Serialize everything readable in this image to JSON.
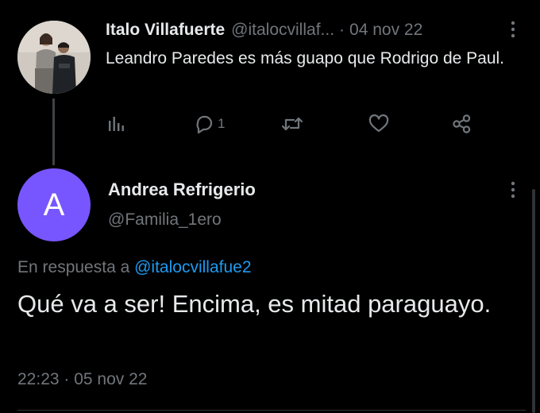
{
  "parent_tweet": {
    "author_name": "Italo Villafuerte",
    "author_handle": "@italocvillaf...",
    "separator": "·",
    "date": "04 nov 22",
    "text": "Leandro Paredes es más guapo que Rodrigo de Paul.",
    "actions": {
      "analytics_icon": "analytics-icon",
      "reply_icon": "reply-icon",
      "reply_count": "1",
      "retweet_icon": "retweet-icon",
      "like_icon": "like-icon",
      "share_icon": "share-icon"
    }
  },
  "reply_tweet": {
    "avatar_letter": "A",
    "avatar_color": "#7856ff",
    "author_name": "Andrea Refrigerio",
    "author_handle": "@Familia_1ero",
    "replying_to_label": "En respuesta a",
    "replying_to_handle": "@italocvillafue2",
    "text": "Qué va a ser! Encima, es mitad paraguayo.",
    "timestamp": "22:23 · 05 nov 22"
  },
  "colors": {
    "background": "#000000",
    "primary_text": "#e7e9ea",
    "secondary_text": "#71767b",
    "link": "#1d9bf0"
  }
}
